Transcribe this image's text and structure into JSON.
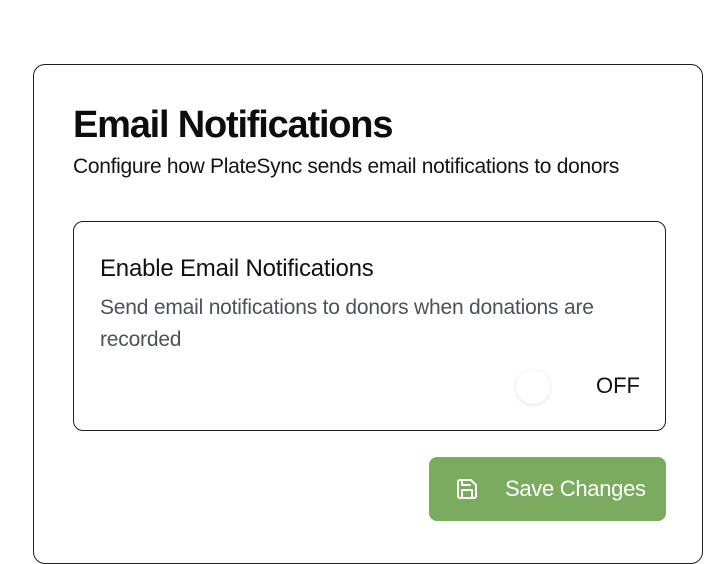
{
  "section": {
    "title": "Email Notifications",
    "subtitle": "Configure how PlateSync sends email notifications to donors"
  },
  "setting": {
    "title": "Enable Email Notifications",
    "description": "Send email notifications to donors when donations are recorded",
    "toggle_state": "OFF"
  },
  "actions": {
    "save_label": "Save Changes",
    "save_icon": "save-icon"
  },
  "colors": {
    "primary_button": "#7aab5f",
    "description_text": "#4a5160",
    "border": "#1f1f1f"
  }
}
